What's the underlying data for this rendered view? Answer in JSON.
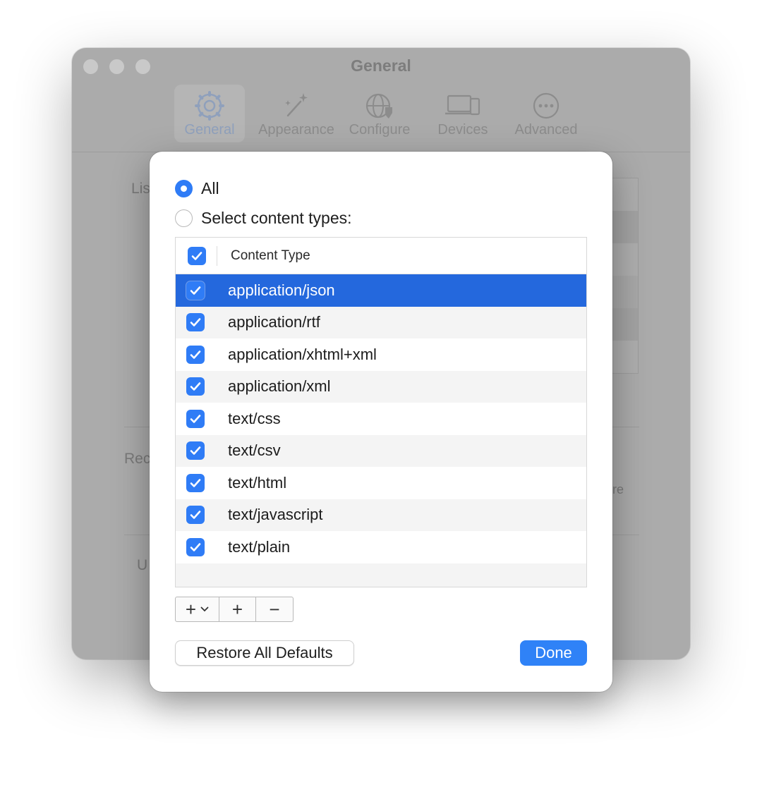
{
  "window": {
    "title": "General",
    "tabs": [
      {
        "label": "General",
        "icon": "gear-icon",
        "selected": true
      },
      {
        "label": "Appearance",
        "icon": "magic-wand-icon",
        "selected": false
      },
      {
        "label": "Configure",
        "icon": "globe-shield-icon",
        "selected": false
      },
      {
        "label": "Devices",
        "icon": "laptop-phone-icon",
        "selected": false
      },
      {
        "label": "Advanced",
        "icon": "ellipsis-circle-icon",
        "selected": false
      }
    ],
    "partial_labels": {
      "list": "Lis",
      "rec": "Rec",
      "u": "U",
      "re": "re"
    }
  },
  "sheet": {
    "radio_all": {
      "label": "All",
      "selected": true
    },
    "radio_select": {
      "label": "Select content types:",
      "selected": false
    },
    "table": {
      "header": "Content Type",
      "header_checked": true,
      "rows": [
        {
          "label": "application/json",
          "checked": true,
          "selected": true
        },
        {
          "label": "application/rtf",
          "checked": true,
          "selected": false
        },
        {
          "label": "application/xhtml+xml",
          "checked": true,
          "selected": false
        },
        {
          "label": "application/xml",
          "checked": true,
          "selected": false
        },
        {
          "label": "text/css",
          "checked": true,
          "selected": false
        },
        {
          "label": "text/csv",
          "checked": true,
          "selected": false
        },
        {
          "label": "text/html",
          "checked": true,
          "selected": false
        },
        {
          "label": "text/javascript",
          "checked": true,
          "selected": false
        },
        {
          "label": "text/plain",
          "checked": true,
          "selected": false
        }
      ]
    },
    "segmented": {
      "add_menu": "+",
      "add": "+",
      "remove": "−"
    },
    "restore_button": "Restore All Defaults",
    "done_button": "Done"
  },
  "colors": {
    "accent": "#2f7cf6",
    "selection": "#2468dd",
    "window_dimmed": "#ababab"
  }
}
